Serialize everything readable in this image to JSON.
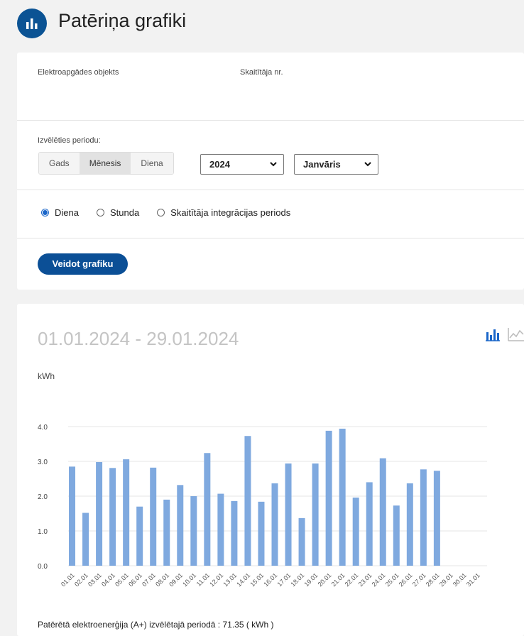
{
  "header": {
    "title": "Patēriņa grafiki",
    "logo_icon": "bar-chart-icon"
  },
  "filters": {
    "object_label": "Elektroapgādes objekts",
    "meter_label": "Skaitītāja nr.",
    "period_label": "Izvēlēties periodu:",
    "period_tabs": [
      {
        "label": "Gads",
        "active": false
      },
      {
        "label": "Mēnesis",
        "active": true
      },
      {
        "label": "Diena",
        "active": false
      }
    ],
    "year_value": "2024",
    "month_value": "Janvāris",
    "granularity": [
      {
        "label": "Diena",
        "selected": true
      },
      {
        "label": "Stunda",
        "selected": false
      },
      {
        "label": "Skaitītāja integrācijas periods",
        "selected": false
      }
    ],
    "build_button": "Veidot grafiku"
  },
  "chart_panel": {
    "range_title": "01.01.2024 - 29.01.2024",
    "unit_label": "kWh",
    "total_text": "Patērētā elektroenerģija (A+) izvēlētajā periodā : 71.35 ( kWh )",
    "view_icons": [
      "bar-chart-icon",
      "line-chart-icon"
    ],
    "accent_color": "#0b4f96",
    "bar_color": "#7fa9df"
  },
  "chart_data": {
    "type": "bar",
    "categories": [
      "01.01",
      "02.01",
      "03.01",
      "04.01",
      "05.01",
      "06.01",
      "07.01",
      "08.01",
      "09.01",
      "10.01",
      "11.01",
      "12.01",
      "13.01",
      "14.01",
      "15.01",
      "16.01",
      "17.01",
      "18.01",
      "19.01",
      "20.01",
      "21.01",
      "22.01",
      "23.01",
      "24.01",
      "25.01",
      "26.01",
      "27.01",
      "28.01",
      "29.01",
      "30.01",
      "31.01"
    ],
    "values": [
      2.85,
      1.52,
      2.98,
      2.81,
      3.06,
      1.7,
      2.82,
      1.9,
      2.32,
      2.0,
      3.24,
      2.07,
      1.86,
      3.73,
      1.84,
      2.37,
      2.94,
      1.37,
      2.94,
      3.88,
      3.94,
      1.96,
      2.4,
      3.09,
      1.73,
      2.37,
      2.77,
      2.73,
      null,
      null,
      null
    ],
    "yticks": [
      "0.0",
      "1.0",
      "2.0",
      "3.0",
      "4.0"
    ],
    "ylim": [
      0,
      4
    ],
    "ylabel": "kWh",
    "grid": true
  }
}
